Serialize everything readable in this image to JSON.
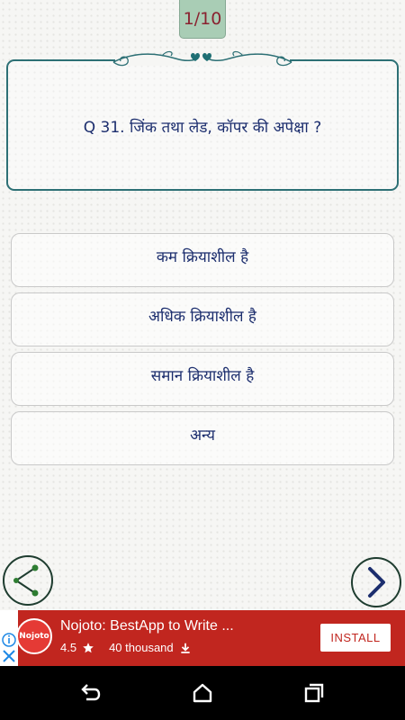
{
  "quiz": {
    "progress": "1/10",
    "question": "Q 31. जिंक तथा लेड, कॉपर की अपेक्षा ?",
    "options": [
      "कम क्रियाशील है",
      "अधिक क्रियाशील है",
      "समान क्रियाशील है",
      "अन्य"
    ]
  },
  "navigation": {
    "prev_icon": "share-icon",
    "next_icon": "chevron-right-icon"
  },
  "ad": {
    "logo_text": "Nojoto",
    "title": "Nojoto: BestApp to Write ...",
    "rating": "4.5",
    "downloads": "40 thousand",
    "install_label": "INSTALL",
    "colors": {
      "background": "#c1261f",
      "logo": "#e53a35"
    }
  },
  "colors": {
    "accent": "#2d7075",
    "text": "#1c2e6e",
    "counter_bg": "#a9cdb5",
    "counter_text": "#8a2230"
  }
}
